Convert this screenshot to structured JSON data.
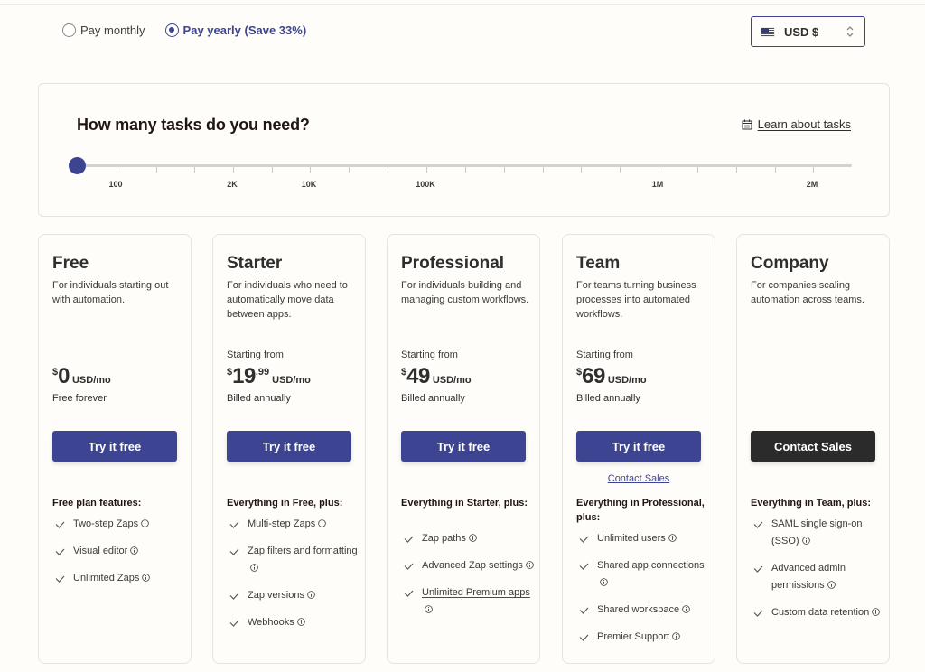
{
  "billing": {
    "options": [
      {
        "label": "Pay monthly",
        "selected": false
      },
      {
        "label": "Pay yearly (Save 33%)",
        "selected": true
      }
    ]
  },
  "currency": {
    "flag_icon": "us-flag-icon",
    "label": "USD $"
  },
  "tasks": {
    "title": "How many tasks do you need?",
    "learn_link": "Learn about tasks",
    "slider": {
      "selected_index": 0,
      "tick_labels": [
        "100",
        "2K",
        "10K",
        "100K",
        "1M",
        "2M"
      ]
    }
  },
  "colors": {
    "accent": "#3d4592",
    "dark_button": "#2b2b2b",
    "background": "#fffdf9"
  },
  "plans": [
    {
      "name": "Free",
      "description": "For individuals starting out with automation.",
      "starting_from": "",
      "currency_symbol": "$",
      "amount": "0",
      "cents": "",
      "unit": "USD/mo",
      "billing_note": "Free forever",
      "cta": "Try it free",
      "contact_link": "",
      "features_heading": "Free plan features:",
      "features": [
        {
          "text": "Two-step Zaps",
          "link": false
        },
        {
          "text": "Visual editor",
          "link": false
        },
        {
          "text": "Unlimited Zaps",
          "link": false
        }
      ]
    },
    {
      "name": "Starter",
      "description": "For individuals who need to automatically move data between apps.",
      "starting_from": "Starting from",
      "currency_symbol": "$",
      "amount": "19",
      "cents": ".99",
      "unit": "USD/mo",
      "billing_note": "Billed annually",
      "cta": "Try it free",
      "contact_link": "",
      "features_heading": "Everything in Free, plus:",
      "features": [
        {
          "text": "Multi-step Zaps",
          "link": false
        },
        {
          "text": "Zap filters and formatting",
          "link": false
        },
        {
          "text": "Zap versions",
          "link": false
        },
        {
          "text": "Webhooks",
          "link": false
        }
      ]
    },
    {
      "name": "Professional",
      "description": "For individuals building and managing custom workflows.",
      "starting_from": "Starting from",
      "currency_symbol": "$",
      "amount": "49",
      "cents": "",
      "unit": "USD/mo",
      "billing_note": "Billed annually",
      "cta": "Try it free",
      "contact_link": "",
      "features_heading": "Everything in Starter, plus:",
      "features": [
        {
          "text": "Zap paths",
          "link": false
        },
        {
          "text": "Advanced Zap settings",
          "link": false
        },
        {
          "text": "Unlimited Premium apps",
          "link": true
        }
      ]
    },
    {
      "name": "Team",
      "description": "For teams turning business processes into automated workflows.",
      "starting_from": "Starting from",
      "currency_symbol": "$",
      "amount": "69",
      "cents": "",
      "unit": "USD/mo",
      "billing_note": "Billed annually",
      "cta": "Try it free",
      "contact_link": "Contact Sales",
      "features_heading": "Everything in Professional, plus:",
      "features": [
        {
          "text": "Unlimited users",
          "link": false
        },
        {
          "text": "Shared app connections",
          "link": false
        },
        {
          "text": "Shared workspace",
          "link": false
        },
        {
          "text": "Premier Support",
          "link": false
        }
      ]
    },
    {
      "name": "Company",
      "description": "For companies scaling automation across teams.",
      "starting_from": "",
      "currency_symbol": "",
      "amount": "",
      "cents": "",
      "unit": "",
      "billing_note": "",
      "cta": "Contact Sales",
      "cta_style": "dark",
      "contact_link": "",
      "features_heading": "Everything in Team, plus:",
      "features": [
        {
          "text": "SAML single sign-on (SSO)",
          "link": false
        },
        {
          "text": "Advanced admin permissions",
          "link": false
        },
        {
          "text": "Custom data retention",
          "link": false
        }
      ]
    }
  ]
}
